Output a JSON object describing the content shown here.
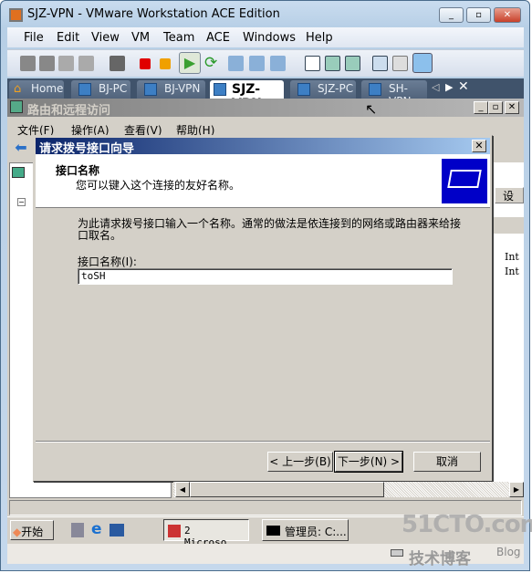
{
  "window": {
    "title": "SJZ-VPN - VMware Workstation ACE Edition",
    "controls": [
      "minimize",
      "restore",
      "close"
    ]
  },
  "menu": [
    "File",
    "Edit",
    "View",
    "VM",
    "Team",
    "ACE",
    "Windows",
    "Help"
  ],
  "tabs": [
    {
      "label": "Home",
      "icon": "home-icon"
    },
    {
      "label": "BJ-PC"
    },
    {
      "label": "BJ-VPN"
    },
    {
      "label": "SJZ-VPN",
      "active": true
    },
    {
      "label": "SJZ-PC"
    },
    {
      "label": "SH-VPN"
    }
  ],
  "guest": {
    "mmc_title": "路由和远程访问",
    "mmc_menu": [
      "文件(F)",
      "操作(A)",
      "查看(V)",
      "帮助(H)"
    ],
    "right_column_header": "设",
    "right_rows": [
      "Int",
      "Int"
    ],
    "dialog": {
      "title": "请求拨号接口向导",
      "header_title": "接口名称",
      "header_subtitle": "您可以键入这个连接的友好名称。",
      "description": "为此请求拨号接口输入一个名称。通常的做法是依连接到的网络或路由器来给接口取名。",
      "field_label": "接口名称(I):",
      "field_value": "toSH",
      "back": "< 上一步(B)",
      "next": "下一步(N) >",
      "cancel": "取消"
    },
    "taskbar": {
      "start": "开始",
      "task1": "2 Microso...",
      "task2": "管理员: C:..."
    }
  },
  "watermark": {
    "site": "51CTO.com",
    "sub": "技术博客",
    "blog": "Blog"
  }
}
